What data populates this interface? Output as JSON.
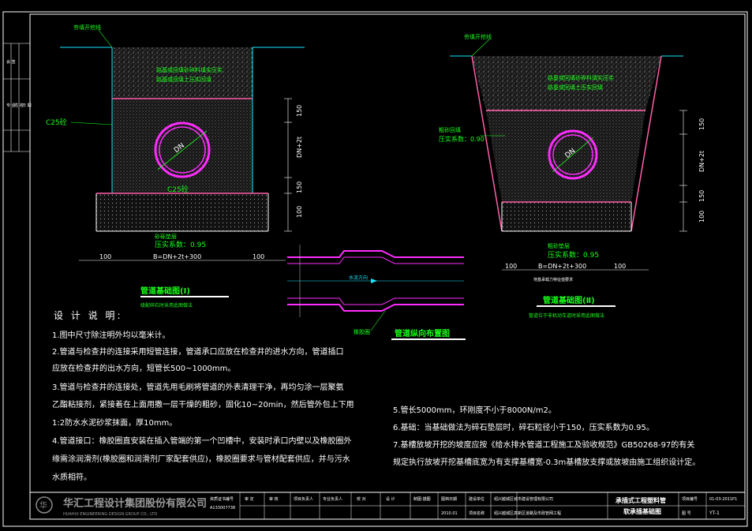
{
  "colors": {
    "background": "#000000",
    "frame": "#ffffff",
    "pipe": "#ff2cff",
    "rebar": "#ff5fa8",
    "ground_line": "#19e6ff",
    "label_green": "#19ff19",
    "dimension": "#ffffff",
    "title_yellow": "#ffd800"
  },
  "section1": {
    "label_backfill": "夯填开挖线",
    "label_fill_note_1": "路基或回填砂碎料填实压实",
    "label_fill_note_2": "路基或回填土压实回填",
    "label_concrete_c25": "C25砼",
    "label_concrete_c25_bottom": "C25砼",
    "label_dn": "DN",
    "label_sand_cushion": "砂砾垫层",
    "label_compaction": "压实系数：0.95",
    "dims": {
      "right_150_top": "150",
      "right_dn2t": "DN+2t",
      "right_150_bottom": "150",
      "right_100": "100",
      "bottom_left_100": "100",
      "bottom_right_100": "100",
      "bottom_width": "B=DN+2t+300"
    },
    "title": "管道基础图(Ⅰ)",
    "subtitle": "级配碎石时采用此图做法"
  },
  "section2": {
    "label_backfill": "夯填开挖线",
    "label_fill_note_1": "路基或回填砂碎料填实压实",
    "label_fill_note_2": "路基或回填土压实回填",
    "label_sand": "粗砂回填",
    "label_compaction_top": "压实系数：0.90",
    "label_dn": "DN",
    "label_sand_cushion": "粗砂垫层",
    "label_compaction_bottom": "压实系数：0.95",
    "dims": {
      "right_150_top": "150",
      "right_dn2t": "DN+2t",
      "right_150_bottom": "150",
      "right_100": "100",
      "bottom_left_100": "100",
      "bottom_right_100": "100",
      "bottom_width": "B=DN+2t+300",
      "bottom_note": "地基承载力特征值要求"
    },
    "title": "管道基础图(Ⅱ)",
    "subtitle": "管道位于非机动车道时采用此图做法"
  },
  "pipe_joint": {
    "label_flow": "水流方向",
    "label_rubber": "橡胶圈",
    "title": "管道纵向布置图"
  },
  "notes": {
    "heading": "设 计 说 明:",
    "left": [
      "1.图中尺寸除注明外均以毫米计。",
      "2.管道与检查井的连接采用短管连接，管道承口应放在检查井的进水方向，管道插口",
      "应放在检查井的出水方向，短管长500~1000mm。",
      "3.管道与检查井的连接处，管道先用毛刷将管道的外表清理干净，再均匀涂一层聚氨",
      "乙酯粘接剂，紧接着在上面用撒一层干燥的粗砂，固化10~20min，然后管外包上下用",
      "1:2防水水泥砂浆抹面，厚10mm。",
      "4.管道接口：橡胶圈直安装在插入管端的第一个凹槽中，安装时承口内壁以及橡胶圈外",
      "缘需涂润滑剂(橡胶圈和润滑剂厂家配套供应)，橡胶圈要求与管材配套供应，并与污水",
      "水质相符。"
    ],
    "right": [
      "5.管长5000mm，环刚度不小于8000N/m2。",
      "6.基础：当基础做法为碎石垫层时，碎石粒径小于150，压实系数为0.95。",
      "7.基槽放坡开挖的坡度应按《给水排水管道工程施工及验收规范》GB50268-97的有关",
      "规定执行放坡开挖基槽底宽为有支撑基槽宽-0.3m基槽放支撑或放坡由施工组织设计定。"
    ]
  },
  "title_block": {
    "company_cn": "华汇工程设计集团股份有限公司",
    "company_en": "HUAHUI ENGINEERING DESIGN GROUP CO., LTD",
    "cert_label": "资质证书编号",
    "cert_no": "A133007738",
    "cells": [
      "审 定",
      "审 核",
      "项目负责人",
      "专业负责人",
      "校 对",
      "设 计",
      "制图·描图",
      "图档日期",
      "建设单位",
      "项目名称"
    ],
    "date": "2010.01",
    "client": "绍兴越城区城市建设管理有限公司",
    "project": "绍兴越城区高新区道路及市政管网工程",
    "drawing_title_1": "承插式工程塑料管",
    "drawing_title_2": "软承插基础图",
    "field_project_no": "项目编号",
    "project_no": "01-03-2011P1",
    "field_sheet": "图 号",
    "sheet_no": "YT-1"
  },
  "left_strip": {
    "labels": [
      "会 签",
      "专 业",
      "姓 名",
      "日 期"
    ]
  }
}
